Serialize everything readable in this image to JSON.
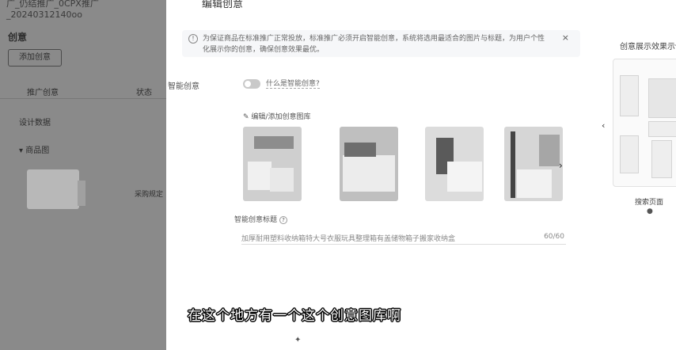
{
  "background": {
    "top_fragment": "广_仍结推广_0CPX推广_20240312140oo",
    "section_title": "创意",
    "add_button": "添加创意",
    "col_left": "推广创意",
    "col_right": "状态",
    "row_1": "设计数据",
    "row_2": "商品图",
    "row_3": "采购规定"
  },
  "drawer": {
    "title": "编辑创意",
    "notice": "为保证商品在标准推广正常投放，标准推广必须开启智能创意，系统将选用最适合的图片与标题，为用户个性化展示你的创意，确保创意效果最优。",
    "close_icon": "×",
    "smart_label": "智能创意",
    "what_is": "什么是智能创意?",
    "edit_link": "编辑/添加创意图库",
    "title_label": "智能创意标题",
    "title_value": "加厚耐用塑料收纳箱特大号衣服玩具整理箱有盖储物箱子搬家收纳盒",
    "title_count": "60/60",
    "preview_title": "创意展示效果示例",
    "preview_label": "搜索页面",
    "preview_dot": "●"
  },
  "subtitle": "在这个地方有一个这个创意图库啊",
  "colors": {
    "overlay": "#8a8a8a",
    "drawer_bg": "#ffffff",
    "subtitle": "#ffffff"
  }
}
